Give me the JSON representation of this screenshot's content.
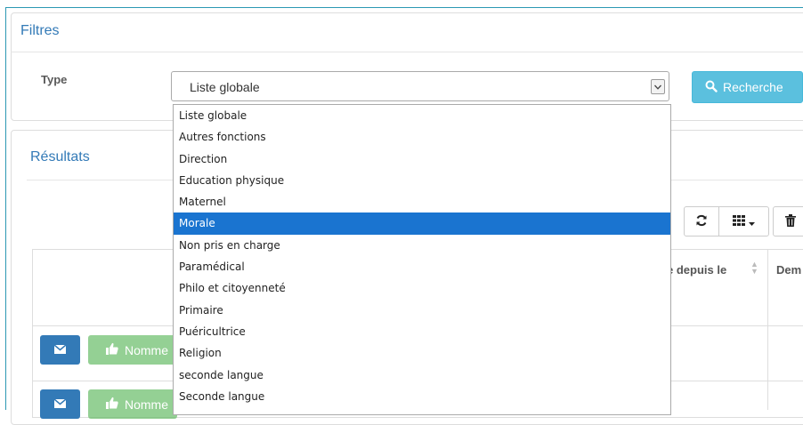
{
  "filters": {
    "title": "Filtres",
    "type_label": "Type",
    "select_value": "Liste globale",
    "search_label": "Recherche"
  },
  "dropdown": {
    "options": [
      {
        "label": "Liste globale"
      },
      {
        "label": "Autres fonctions"
      },
      {
        "label": "Direction"
      },
      {
        "label": "Education physique"
      },
      {
        "label": "Maternel"
      },
      {
        "label": "Morale",
        "selected": true
      },
      {
        "label": "Non pris en charge"
      },
      {
        "label": "Paramédical"
      },
      {
        "label": "Philo et citoyenneté"
      },
      {
        "label": "Primaire"
      },
      {
        "label": "Puéricultrice"
      },
      {
        "label": "Religion"
      },
      {
        "label": "seconde langue"
      },
      {
        "label": "Seconde langue"
      }
    ]
  },
  "results": {
    "title": "Résultats",
    "columns": [
      "e depuis le",
      "Dem"
    ],
    "rows": [
      {
        "name_button": "Nomme"
      },
      {
        "name_button": "Nomme"
      }
    ]
  },
  "colors": {
    "accent": "#5bc0de",
    "primary": "#337ab7",
    "success": "#5cb85c",
    "selected": "#1a74d0"
  }
}
